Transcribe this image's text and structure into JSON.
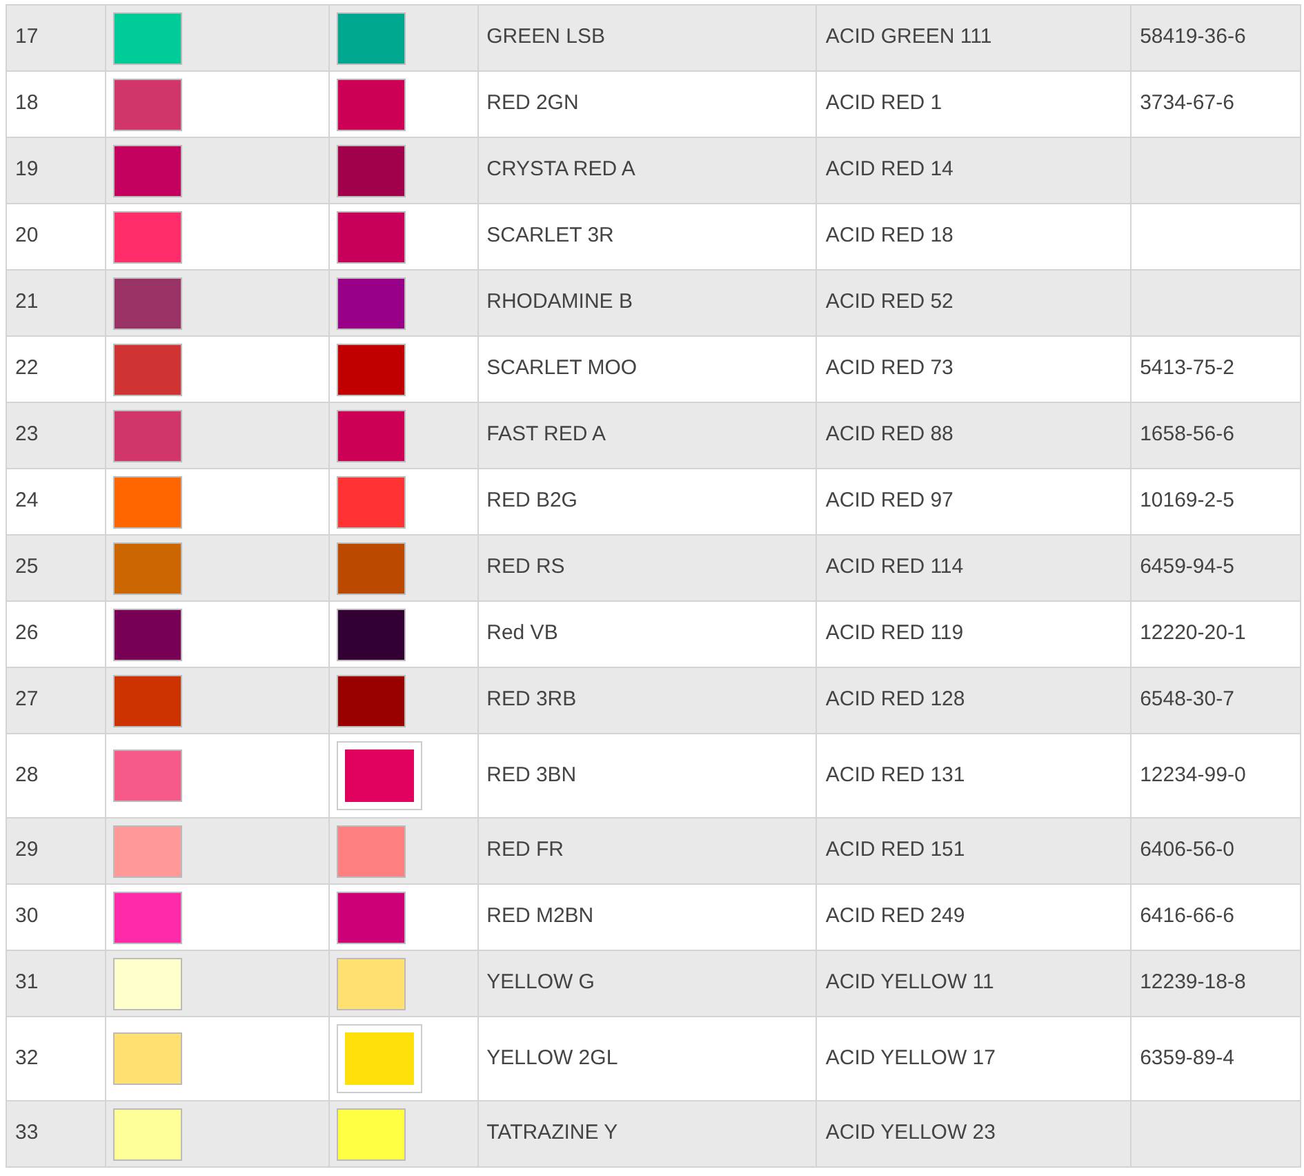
{
  "rows": [
    {
      "no": "17",
      "shade": {
        "color": "#00cc99"
      },
      "dyed": {
        "color": "#00a78f",
        "kind": "plain"
      },
      "name": "GREEN LSB",
      "ci": "ACID GREEN 111",
      "cas": "58419-36-6"
    },
    {
      "no": "18",
      "shade": {
        "color": "#d1366a"
      },
      "dyed": {
        "color": "#cc0055",
        "kind": "plain"
      },
      "name": "RED 2GN",
      "ci": "ACID RED 1",
      "cas": "3734-67-6"
    },
    {
      "no": "19",
      "shade": {
        "color": "#c4005e"
      },
      "dyed": {
        "color": "#a1004a",
        "kind": "plain"
      },
      "name": "CRYSTA RED A",
      "ci": "ACID RED 14"
    },
    {
      "no": "20",
      "shade": {
        "color": "#ff2e6a"
      },
      "dyed": {
        "color": "#c70059",
        "kind": "plain"
      },
      "name": "SCARLET 3R",
      "ci": "ACID RED 18"
    },
    {
      "no": "21",
      "shade": {
        "color": "#993366"
      },
      "dyed": {
        "color": "#990088",
        "kind": "plain"
      },
      "name": "RHODAMINE B",
      "ci": "ACID RED 52"
    },
    {
      "no": "22",
      "shade": {
        "color": "#cf3333"
      },
      "dyed": {
        "color": "#c00000",
        "kind": "plain"
      },
      "name": "SCARLET MOO",
      "ci": "ACID RED 73",
      "cas": "5413-75-2"
    },
    {
      "no": "23",
      "shade": {
        "color": "#d1366a"
      },
      "dyed": {
        "color": "#cc0055",
        "kind": "plain"
      },
      "name": "FAST RED A",
      "ci": "ACID RED 88",
      "cas": "1658-56-6"
    },
    {
      "no": "24",
      "shade": {
        "color": "#ff6600"
      },
      "dyed": {
        "color": "#ff3333",
        "kind": "plain"
      },
      "name": "RED B2G",
      "ci": "ACID RED 97",
      "cas": "10169-2-5"
    },
    {
      "no": "25",
      "shade": {
        "color": "#cc6600"
      },
      "dyed": {
        "color": "#bb4a00",
        "kind": "plain"
      },
      "name": "RED RS",
      "ci": "ACID RED 114",
      "cas": "6459-94-5"
    },
    {
      "no": "26",
      "shade": {
        "color": "#770055"
      },
      "dyed": {
        "color": "#330033",
        "kind": "plain"
      },
      "name": "Red VB",
      "ci": "ACID RED 119",
      "cas": "12220-20-1"
    },
    {
      "no": "27",
      "shade": {
        "color": "#cc3300"
      },
      "dyed": {
        "color": "#990000",
        "kind": "plain"
      },
      "name": "RED 3RB",
      "ci": "ACID RED 128",
      "cas": "6548-30-7"
    },
    {
      "no": "28",
      "shade": {
        "color": "#f55a88"
      },
      "dyed": {
        "color": "#e0005e",
        "kind": "framed"
      },
      "name": "RED 3BN",
      "ci": "ACID RED 131",
      "cas": "12234-99-0"
    },
    {
      "no": "29",
      "shade": {
        "color": "#ff9999"
      },
      "dyed": {
        "color": "#ff8080",
        "kind": "plain"
      },
      "name": "RED FR",
      "ci": "ACID RED 151",
      "cas": "6406-56-0"
    },
    {
      "no": "30",
      "shade": {
        "color": "#ff2aaa"
      },
      "dyed": {
        "color": "#cc0077",
        "kind": "plain"
      },
      "name": "RED M2BN",
      "ci": "ACID RED 249",
      "cas": "6416-66-6"
    },
    {
      "no": "31",
      "shade": {
        "color": "#ffffcc"
      },
      "dyed": {
        "color": "#ffe070",
        "kind": "plain"
      },
      "name": "YELLOW G",
      "ci": "ACID YELLOW 11",
      "cas": "12239-18-8"
    },
    {
      "no": "32",
      "shade": {
        "color": "#ffe070"
      },
      "dyed": {
        "color": "#ffe00a",
        "kind": "framed"
      },
      "name": "YELLOW 2GL",
      "ci": "ACID YELLOW 17",
      "cas": "6359-89-4"
    },
    {
      "no": "33",
      "shade": {
        "color": "#ffff99"
      },
      "dyed": {
        "color": "#ffff44",
        "kind": "plain"
      },
      "name": "TATRAZINE Y",
      "ci": "ACID YELLOW 23"
    }
  ]
}
